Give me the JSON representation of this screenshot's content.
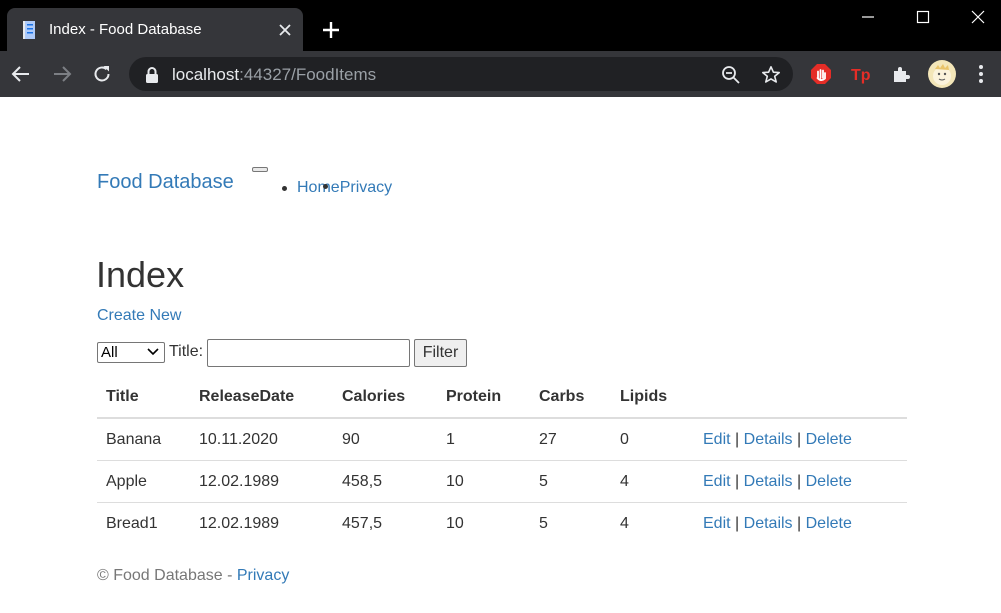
{
  "browser": {
    "tab_title": "Index - Food Database",
    "url_host": "localhost",
    "url_rest": ":44327/FoodItems"
  },
  "site": {
    "brand": "Food Database",
    "nav": [
      "Home",
      "Privacy"
    ]
  },
  "main": {
    "heading": "Index",
    "create_new": "Create New",
    "filter": {
      "select_value": "All",
      "title_label": "Title:",
      "title_value": "",
      "button_label": "Filter"
    },
    "table": {
      "headers": [
        "Title",
        "ReleaseDate",
        "Calories",
        "Protein",
        "Carbs",
        "Lipids"
      ],
      "rows": [
        [
          "Banana",
          "10.11.2020",
          "90",
          "1",
          "27",
          "0"
        ],
        [
          "Apple",
          "12.02.1989",
          "458,5",
          "10",
          "5",
          "4"
        ],
        [
          "Bread1",
          "12.02.1989",
          "457,5",
          "10",
          "5",
          "4"
        ]
      ],
      "actions": {
        "edit": "Edit",
        "details": "Details",
        "delete": "Delete",
        "separator": "|"
      }
    }
  },
  "footer": {
    "copyright": "© Food Database - ",
    "privacy": "Privacy"
  }
}
